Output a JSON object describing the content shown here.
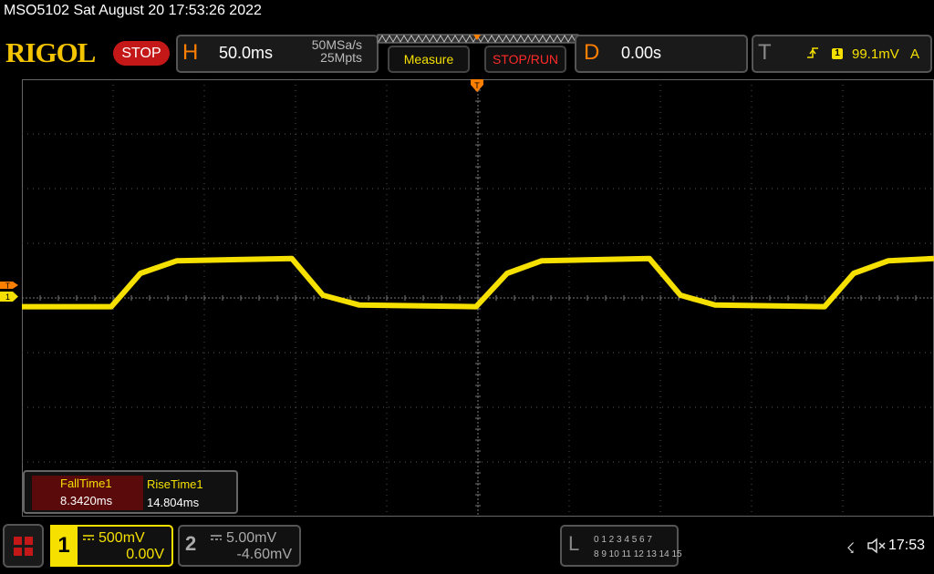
{
  "title_bar": "MSO5102  Sat August 20 17:53:26 2022",
  "brand": "RIGOL",
  "run_state": "STOP",
  "horizontal": {
    "letter": "H",
    "time_base": "50.0ms",
    "sample_rate": "50MSa/s",
    "memory_depth": "25Mpts"
  },
  "buttons": {
    "measure": "Measure",
    "stop_run": "STOP/RUN"
  },
  "delay": {
    "letter": "D",
    "value": "0.00s"
  },
  "trigger": {
    "letter": "T",
    "source": "1",
    "level": "99.1mV",
    "mode": "A"
  },
  "markers": {
    "ch1": "1",
    "trigger": "T"
  },
  "measurements": {
    "fall_label": "FallTime1",
    "fall_value": "8.3420ms",
    "rise_label": "RiseTime1",
    "rise_value": "14.804ms"
  },
  "channel1": {
    "number": "1",
    "scale": "500mV",
    "offset": "0.00V"
  },
  "channel2": {
    "number": "2",
    "scale": "5.00mV",
    "offset": "-4.60mV"
  },
  "logic_analyzer": {
    "letter": "L",
    "row1": "0 1 2 3  4 5 6 7",
    "row2": "8 9 10 11  12 13 14 15"
  },
  "status": {
    "usb_icon": "usb-icon",
    "sound_icon": "speaker-muted-icon",
    "clock": "17:53"
  },
  "colors": {
    "ch1": "#f5e000",
    "accent": "#ff7f00",
    "stop": "#c41818"
  },
  "chart_data": {
    "type": "line",
    "xlabel": "",
    "ylabel": "",
    "x_divisions": 10,
    "y_divisions": 8,
    "x_units_per_div": "50.0ms",
    "y_units_per_div": "500mV",
    "grid": true,
    "series": [
      {
        "points_div": [
          [
            -5.0,
            -0.16
          ],
          [
            -4.02,
            -0.16
          ],
          [
            -3.7,
            0.45
          ],
          [
            -3.3,
            0.68
          ],
          [
            -2.04,
            0.72
          ],
          [
            -1.7,
            0.05
          ],
          [
            -1.3,
            -0.13
          ],
          [
            -0.02,
            -0.16
          ],
          [
            0.32,
            0.45
          ],
          [
            0.7,
            0.68
          ],
          [
            1.88,
            0.72
          ],
          [
            2.22,
            0.05
          ],
          [
            2.6,
            -0.13
          ],
          [
            3.8,
            -0.16
          ],
          [
            4.12,
            0.45
          ],
          [
            4.5,
            0.68
          ],
          [
            5.0,
            0.72
          ]
        ]
      }
    ]
  }
}
